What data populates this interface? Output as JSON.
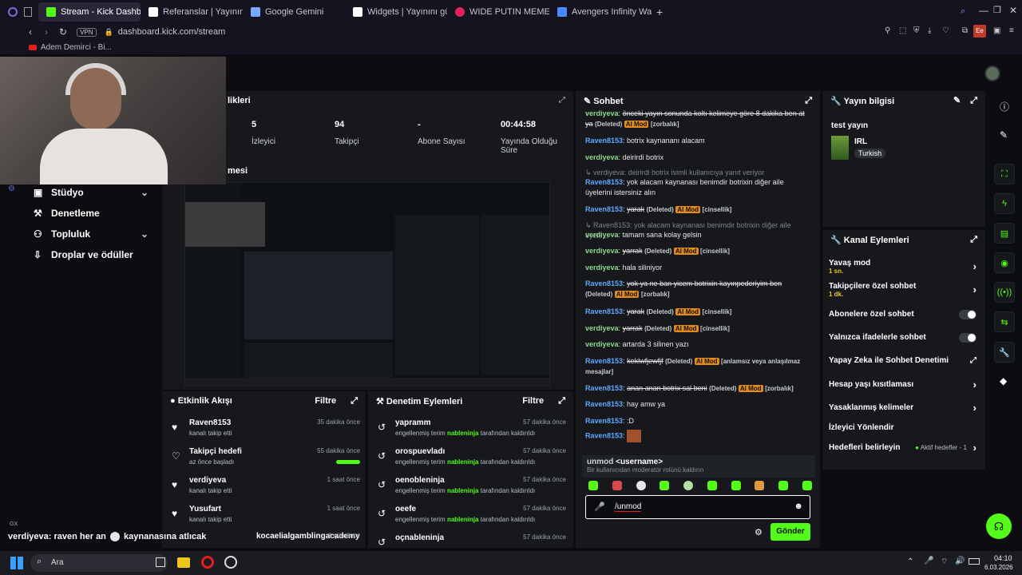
{
  "browser": {
    "tabs": [
      {
        "label": "Stream - Kick Dashboard",
        "color": "#53fc18",
        "active": true
      },
      {
        "label": "Referanslar | Yayınını güçle",
        "color": "#ffffff",
        "active": false
      },
      {
        "label": "Google Gemini",
        "color": "#7aa7ff",
        "active": false
      },
      {
        "label": "Widgets | Yayınını güçlend",
        "color": "#ffffff",
        "active": false
      },
      {
        "label": "WIDE PUTIN MEME - Insta",
        "color": "#e0245e",
        "active": false
      },
      {
        "label": "Avengers Infinity War GIF",
        "color": "#4a8cff",
        "active": false
      }
    ],
    "vpn": "VPN",
    "url": "dashboard.kick.com/stream",
    "bookmark": "Adem Demirci - Bi...",
    "profile_initials": "Ee"
  },
  "stats": {
    "title": "likleri",
    "items": [
      {
        "value": "5",
        "label": "İzleyici"
      },
      {
        "value": "94",
        "label": "Takipçi"
      },
      {
        "value": "-",
        "label": "Abone Sayısı"
      },
      {
        "value": "00:44:58",
        "label": "Yayında Olduğu Süre"
      }
    ],
    "preview_title": "mesi"
  },
  "sidebar": {
    "items": [
      {
        "label": "Stüdyo",
        "icon": "studio-icon",
        "chevron": true
      },
      {
        "label": "Denetleme",
        "icon": "hammer-icon",
        "chevron": false
      },
      {
        "label": "Topluluk",
        "icon": "community-icon",
        "chevron": true
      },
      {
        "label": "Droplar ve ödüller",
        "icon": "drops-icon",
        "chevron": false
      }
    ]
  },
  "activity": {
    "title": "Etkinlik Akışı",
    "filter": "Filtre",
    "rows": [
      {
        "name": "Raven8153",
        "desc": "kanalı takip etti",
        "time": "35 dakika önce"
      },
      {
        "name": "Takipçi hedefi",
        "desc": "az önce başladı",
        "time": "55 dakika önce",
        "progress": 1.0
      },
      {
        "name": "verdiyeva",
        "desc": "kanalı takip etti",
        "time": "1 saat önce"
      },
      {
        "name": "Yusufart",
        "desc": "kanalı takip etti",
        "time": "1 saat önce"
      },
      {
        "name": "kocaelialgamblingacademy",
        "desc": "",
        "time": "1 gün önce"
      }
    ]
  },
  "moderation": {
    "title": "Denetim Eylemleri",
    "filter": "Filtre",
    "rows": [
      {
        "term": "yapramm",
        "pre": "engellenmiş terim",
        "by": "nableninja",
        "post": "tarafından kaldırıldı",
        "time": "57 dakika önce"
      },
      {
        "term": "orospuevladı",
        "pre": "engellenmiş terim",
        "by": "nableninja",
        "post": "tarafından kaldırıldı",
        "time": "57 dakika önce"
      },
      {
        "term": "oenobleninja",
        "pre": "engellenmiş terim",
        "by": "nableninja",
        "post": "tarafından kaldırıldı",
        "time": "57 dakika önce"
      },
      {
        "term": "oeefe",
        "pre": "engellenmiş terim",
        "by": "nableninja",
        "post": "tarafından kaldırıldı",
        "time": "57 dakika önce"
      },
      {
        "term": "oçnableninja",
        "pre": "",
        "by": "",
        "post": "",
        "time": "57 dakika önce"
      }
    ]
  },
  "chat": {
    "title": "Sohbet",
    "ai_badge": "AI Mod",
    "deleted": "(Deleted)",
    "suggestion": {
      "command": "unmod",
      "arg": "<username>",
      "desc": "Bir kullanıcıdan moderatör rolünü kaldırın"
    },
    "input_value": "/unmod",
    "send": "Gönder",
    "overlay": {
      "user": "verdiyeva",
      "text": ": raven her an",
      "text2": "kaynanasına atlıcak"
    }
  },
  "info": {
    "title": "Yayın bilgisi",
    "stream_title": "test yayın",
    "category": "IRL",
    "language": "Turkish"
  },
  "channel_actions": {
    "title": "Kanal Eylemleri",
    "items": [
      {
        "label": "Yavaş mod",
        "sub": "1 sn.",
        "control": "chevron"
      },
      {
        "label": "Takipçilere özel sohbet",
        "sub": "1 dk.",
        "control": "chevron"
      },
      {
        "label": "Abonelere özel sohbet",
        "sub": "",
        "control": "toggle"
      },
      {
        "label": "Yalnızca ifadelerle sohbet",
        "sub": "",
        "control": "toggle"
      },
      {
        "label": "Yapay Zeka ile Sohbet Denetimi",
        "sub": "",
        "control": "external"
      },
      {
        "label": "Hesap yaşı kısıtlaması",
        "sub": "",
        "control": "chevron"
      },
      {
        "label": "Yasaklanmış kelimeler",
        "sub": "",
        "control": "chevron"
      },
      {
        "label": "İzleyici Yönlendir",
        "sub": "",
        "control": "none"
      },
      {
        "label": "Hedefleri belirleyin",
        "sub": "",
        "control": "chevron",
        "status": "Aktif hedefler - 1"
      }
    ]
  },
  "taskbar": {
    "search": "Ara",
    "time": "04:10",
    "date": "6.03.2026"
  },
  "overlay_gx": "GX",
  "colors": {
    "accent": "#53fc18",
    "ai_badge": "#e38b1c",
    "username": "#5fa8ff"
  }
}
